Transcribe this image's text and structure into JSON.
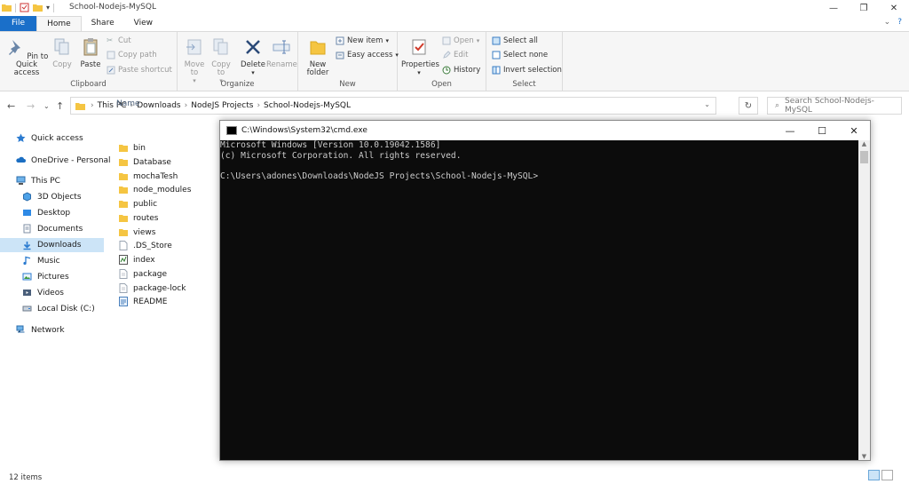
{
  "window": {
    "title": "School-Nodejs-MySQL"
  },
  "tabs": [
    {
      "label": "File"
    },
    {
      "label": "Home"
    },
    {
      "label": "Share"
    },
    {
      "label": "View"
    }
  ],
  "ribbon": {
    "clipboard": {
      "label": "Clipboard",
      "pin": "Pin to Quick access",
      "copy": "Copy",
      "paste": "Paste",
      "cut": "Cut",
      "copy_path": "Copy path",
      "paste_shortcut": "Paste shortcut"
    },
    "organize": {
      "label": "Organize",
      "move_to": "Move to",
      "copy_to": "Copy to",
      "delete": "Delete",
      "rename": "Rename"
    },
    "new": {
      "label": "New",
      "new_folder": "New folder",
      "new_item": "New item",
      "easy_access": "Easy access"
    },
    "open": {
      "label": "Open",
      "properties": "Properties",
      "open": "Open",
      "edit": "Edit",
      "history": "History"
    },
    "select": {
      "label": "Select",
      "select_all": "Select all",
      "select_none": "Select none",
      "invert": "Invert selection"
    }
  },
  "address": {
    "segments": [
      "This PC",
      "Downloads",
      "NodeJS Projects",
      "School-Nodejs-MySQL"
    ],
    "search_placeholder": "Search School-Nodejs-MySQL"
  },
  "sidebar": {
    "items": [
      {
        "label": "Quick access",
        "icon": "star-icon"
      },
      {
        "label": "OneDrive - Personal",
        "icon": "cloud-icon"
      },
      {
        "label": "This PC",
        "icon": "computer-icon"
      },
      {
        "label": "3D Objects",
        "icon": "cube-icon"
      },
      {
        "label": "Desktop",
        "icon": "desktop-icon"
      },
      {
        "label": "Documents",
        "icon": "document-icon"
      },
      {
        "label": "Downloads",
        "icon": "download-icon"
      },
      {
        "label": "Music",
        "icon": "music-icon"
      },
      {
        "label": "Pictures",
        "icon": "picture-icon"
      },
      {
        "label": "Videos",
        "icon": "video-icon"
      },
      {
        "label": "Local Disk (C:)",
        "icon": "disk-icon"
      },
      {
        "label": "Network",
        "icon": "network-icon"
      }
    ]
  },
  "files": {
    "column_name": "Name",
    "items": [
      {
        "name": "bin",
        "type": "folder"
      },
      {
        "name": "Database",
        "type": "folder"
      },
      {
        "name": "mochaTesh",
        "type": "folder"
      },
      {
        "name": "node_modules",
        "type": "folder"
      },
      {
        "name": "public",
        "type": "folder"
      },
      {
        "name": "routes",
        "type": "folder"
      },
      {
        "name": "views",
        "type": "folder"
      },
      {
        "name": ".DS_Store",
        "type": "file"
      },
      {
        "name": "index",
        "type": "js"
      },
      {
        "name": "package",
        "type": "json"
      },
      {
        "name": "package-lock",
        "type": "json"
      },
      {
        "name": "README",
        "type": "md"
      }
    ]
  },
  "status": {
    "count": "12 items"
  },
  "cmd": {
    "title": "C:\\Windows\\System32\\cmd.exe",
    "lines": [
      "Microsoft Windows [Version 10.0.19042.1586]",
      "(c) Microsoft Corporation. All rights reserved.",
      "",
      "C:\\Users\\adones\\Downloads\\NodeJS Projects\\School-Nodejs-MySQL>"
    ]
  },
  "colors": {
    "file_tab": "#1a6fc9",
    "selection": "#cce4f7",
    "console_bg": "#0c0c0c",
    "console_text": "#cccccc",
    "folder": "#f5c542"
  }
}
